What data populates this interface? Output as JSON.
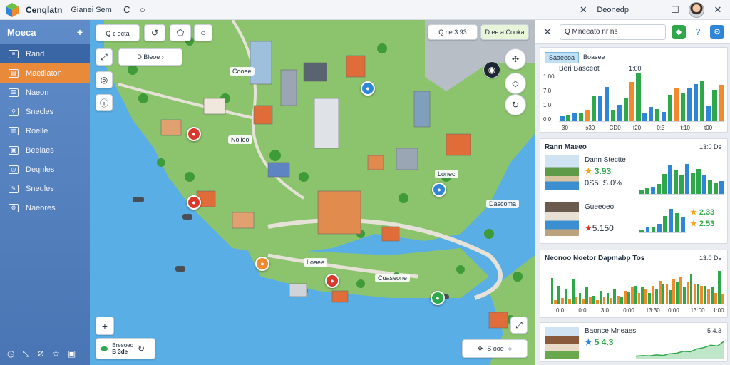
{
  "app": {
    "title": "Cenqlatn",
    "menu": "Gianei Sem",
    "user_label": "Deonedp"
  },
  "titlebar_icons": [
    "refresh-icon",
    "search-icon"
  ],
  "sidebar": {
    "header": "Moeca",
    "items": [
      {
        "label": "Rand",
        "icon": "layers-icon",
        "state": "active-blue"
      },
      {
        "label": "Maetllaton",
        "icon": "map-icon",
        "state": "active-orange"
      },
      {
        "label": "Naeon",
        "icon": "list-icon",
        "state": ""
      },
      {
        "label": "Snecles",
        "icon": "filter-icon",
        "state": ""
      },
      {
        "label": "Roelle",
        "icon": "chart-icon",
        "state": ""
      },
      {
        "label": "Beelaes",
        "icon": "image-icon",
        "state": ""
      },
      {
        "label": "Deqnles",
        "icon": "clock-icon",
        "state": ""
      },
      {
        "label": "Sneules",
        "icon": "edit-icon",
        "state": ""
      },
      {
        "label": "Naeores",
        "icon": "settings-icon",
        "state": ""
      }
    ]
  },
  "map": {
    "search_top_left": "Q  ꞓ ecta",
    "top_right_label": "Q ne 3 93",
    "top_right_badge": "D ee a Cooka",
    "nav_label": "D  Bleoe",
    "bottom_right_label": "S ooe",
    "bottom_left_label": "B 3de",
    "bottom_left_title": "Bresoeo",
    "place_labels": [
      "Cooee",
      "Noiieo",
      "Loaee",
      "Cuaseone",
      "Lonec",
      "Dascoma"
    ]
  },
  "panel": {
    "search_text": "Q  Mneeato  nr ns",
    "card1": {
      "tab_active": "Saaeeoa",
      "tab": "Boasee",
      "heading": "Beri Basceot",
      "label_right": "1:00",
      "y_ticks": [
        "1:00",
        "7:0",
        "1:0",
        "0:0"
      ],
      "x_ticks": [
        "30",
        "ɔ30",
        "CD0",
        "t20",
        "0:3",
        "t:10",
        "t00"
      ],
      "chart_data": {
        "type": "bar",
        "categories": [
          "1",
          "2",
          "3",
          "4",
          "5",
          "6",
          "7",
          "8",
          "9",
          "10",
          "11",
          "12",
          "13",
          "14",
          "15",
          "16",
          "17",
          "18",
          "19",
          "20",
          "21",
          "22",
          "23",
          "24",
          "25",
          "26"
        ],
        "series": [
          {
            "color": "#2f86d6",
            "values": [
              0.1,
              0.14,
              0.18,
              0.18,
              0.22,
              0.52,
              0.54,
              0.72,
              0.22,
              0.35,
              0.48,
              0.82,
              1.0,
              0.16,
              0.3,
              0.26,
              0.2,
              0.55,
              0.68,
              0.6,
              0.7,
              0.78,
              0.84,
              0.32,
              0.66,
              0.76
            ]
          }
        ]
      }
    },
    "card2": {
      "title": "Rann Maeeo",
      "meta": "13:0 Ds",
      "items": [
        {
          "name": "Dann Stectte",
          "rating": "3.93",
          "price": "0S5. S.0%"
        },
        {
          "name": "Gueeoeo",
          "rating": "",
          "price": "5.150"
        }
      ],
      "right_ratings": [
        "2.33",
        "2.53"
      ],
      "chart_data": {
        "type": "bar",
        "categories": [
          "1",
          "2",
          "3",
          "4",
          "5",
          "6",
          "7",
          "8",
          "9",
          "10",
          "11",
          "12",
          "13",
          "14",
          "15"
        ],
        "values": [
          0.1,
          0.18,
          0.2,
          0.3,
          0.6,
          0.85,
          0.7,
          0.55,
          0.9,
          0.62,
          0.75,
          0.58,
          0.42,
          0.32,
          0.38
        ]
      }
    },
    "card3": {
      "title": "Neonoo Noetor Dapmabp Tos",
      "meta": "13:0 Ds",
      "x_ticks": [
        "0:0",
        "0:0",
        "3:0",
        "0:00",
        "13:30",
        "0:00",
        "13:00",
        "1:00"
      ],
      "chart_data": {
        "type": "bar",
        "categories": [
          "1",
          "2",
          "3",
          "4",
          "5",
          "6",
          "7",
          "8",
          "9",
          "10",
          "11",
          "12",
          "13",
          "14",
          "15",
          "16",
          "17",
          "18",
          "19",
          "20",
          "21",
          "22",
          "23",
          "24",
          "25"
        ],
        "series": [
          {
            "name": "green",
            "color": "#2ea84a",
            "values": [
              0.7,
              0.5,
              0.42,
              0.66,
              0.3,
              0.45,
              0.22,
              0.35,
              0.3,
              0.4,
              0.2,
              0.32,
              0.5,
              0.48,
              0.3,
              0.42,
              0.55,
              0.38,
              0.6,
              0.48,
              0.8,
              0.55,
              0.5,
              0.45,
              0.9
            ]
          },
          {
            "name": "orange",
            "color": "#f08a2c",
            "values": [
              0.1,
              0.15,
              0.12,
              0.2,
              0.12,
              0.18,
              0.1,
              0.2,
              0.16,
              0.22,
              0.35,
              0.48,
              0.3,
              0.4,
              0.5,
              0.62,
              0.52,
              0.68,
              0.75,
              0.6,
              0.55,
              0.5,
              0.4,
              0.3,
              0.25
            ]
          }
        ]
      }
    },
    "card4": {
      "name": "Baonce Mneaes",
      "rating": "5 4.3",
      "meta": "5 4.3",
      "chart_data": {
        "type": "area",
        "x": [
          1,
          2,
          3,
          4,
          5,
          6,
          7,
          8,
          9,
          10,
          11,
          12,
          13,
          14
        ],
        "y": [
          0.1,
          0.12,
          0.11,
          0.15,
          0.13,
          0.2,
          0.22,
          0.3,
          0.28,
          0.4,
          0.45,
          0.55,
          0.52,
          0.72
        ]
      }
    }
  },
  "colors": {
    "sidebar": "#5680c0",
    "accent_orange": "#e88a3a",
    "accent_green": "#2ea84a",
    "accent_blue": "#2f86d6",
    "water": "#5aaee6",
    "land": "#8cc46e"
  }
}
